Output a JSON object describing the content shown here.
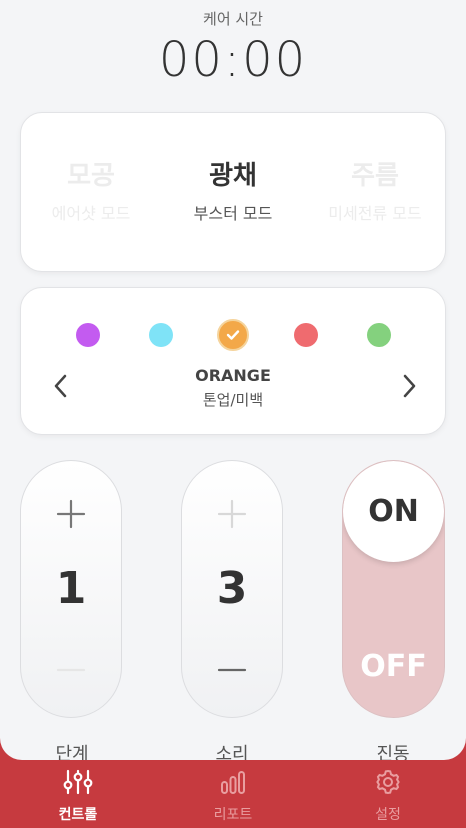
{
  "header": {
    "care_label": "케어 시간",
    "timer": "00:00"
  },
  "modes": [
    {
      "title": "모공",
      "subtitle": "에어샷 모드"
    },
    {
      "title": "광채",
      "subtitle": "부스터 모드"
    },
    {
      "title": "주름",
      "subtitle": "미세전류 모드"
    }
  ],
  "colors": {
    "options": [
      "#c35bf0",
      "#7fe3f7",
      "#f3a849",
      "#ef6b6f",
      "#84d17e"
    ],
    "selected_name": "ORANGE",
    "selected_desc": "톤업/미백",
    "prev_icon": "chevron-left-icon",
    "next_icon": "chevron-right-icon"
  },
  "controls": {
    "level": {
      "value": "1",
      "label": "단계"
    },
    "sound": {
      "value": "3",
      "label": "소리"
    },
    "vibration": {
      "on_label": "ON",
      "off_label": "OFF",
      "label": "진동"
    }
  },
  "tabs": [
    {
      "label": "컨트롤",
      "icon": "sliders-icon",
      "active": true
    },
    {
      "label": "리포트",
      "icon": "bar-chart-icon",
      "active": false
    },
    {
      "label": "설정",
      "icon": "gear-icon",
      "active": false
    }
  ],
  "theme": {
    "accent": "#c63a3f",
    "toggle_bg": "#e8c6c8"
  }
}
